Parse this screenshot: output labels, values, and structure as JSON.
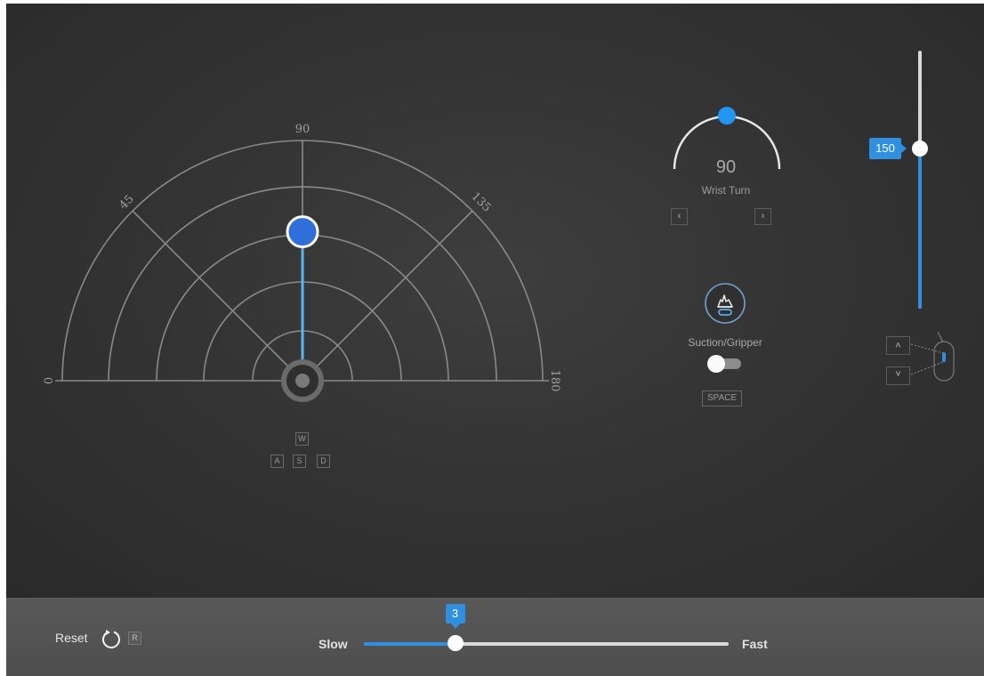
{
  "radar": {
    "tick_0": "0",
    "tick_45": "45",
    "tick_90": "90",
    "tick_135": "135",
    "tick_180": "180",
    "angle": 90,
    "reach_fraction": 0.62
  },
  "keys": {
    "w": "W",
    "a": "A",
    "s": "S",
    "d": "D"
  },
  "wrist": {
    "value": "90",
    "label": "Wrist Turn",
    "left_arrow": "‹",
    "right_arrow": "›"
  },
  "gripper": {
    "label": "Suction/Gripper",
    "enabled": false,
    "key": "SPACE"
  },
  "height": {
    "value": "150",
    "level_fraction": 0.62,
    "up_arrow": "˄",
    "down_arrow": "˅"
  },
  "speed": {
    "value": "3",
    "slow_label": "Slow",
    "fast_label": "Fast",
    "level_fraction": 0.25
  },
  "reset": {
    "label": "Reset",
    "key": "R"
  },
  "colors": {
    "accent": "#2f8fe0",
    "knob_blue": "#2f6fdc",
    "track": "#d9d9d9",
    "grid": "#8a8a8a"
  },
  "icons": {
    "reset": "rotate-ccw-icon",
    "gripper": "gripper-hand-icon",
    "mouse": "mouse-scroll-icon"
  }
}
